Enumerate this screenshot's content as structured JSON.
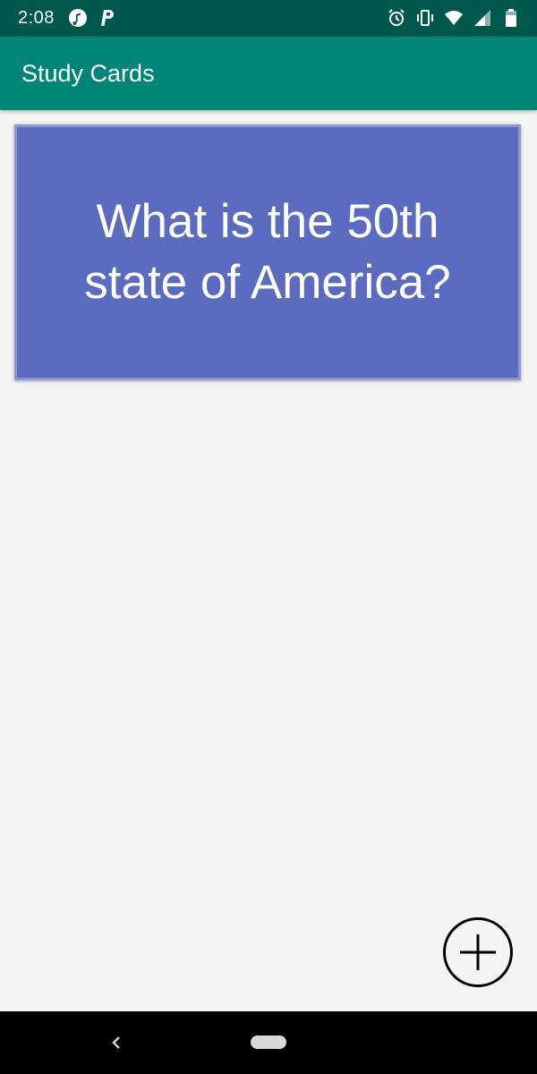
{
  "status_bar": {
    "time": "2:08",
    "left_icons": [
      "music-note-icon",
      "parking-p-icon"
    ],
    "right_icons": [
      "alarm-icon",
      "vibrate-icon",
      "wifi-icon",
      "signal-icon",
      "battery-icon"
    ]
  },
  "app_bar": {
    "title": "Study Cards"
  },
  "card": {
    "question": "What is the 50th state of America?"
  },
  "fab": {
    "icon": "plus-icon"
  },
  "nav_bar": {
    "back_icon": "back-chevron-icon",
    "home_icon": "home-pill-icon"
  },
  "colors": {
    "status_bar": "#00574b",
    "app_bar": "#008577",
    "card": "#5b6bbf",
    "background": "#f4f5f3"
  }
}
